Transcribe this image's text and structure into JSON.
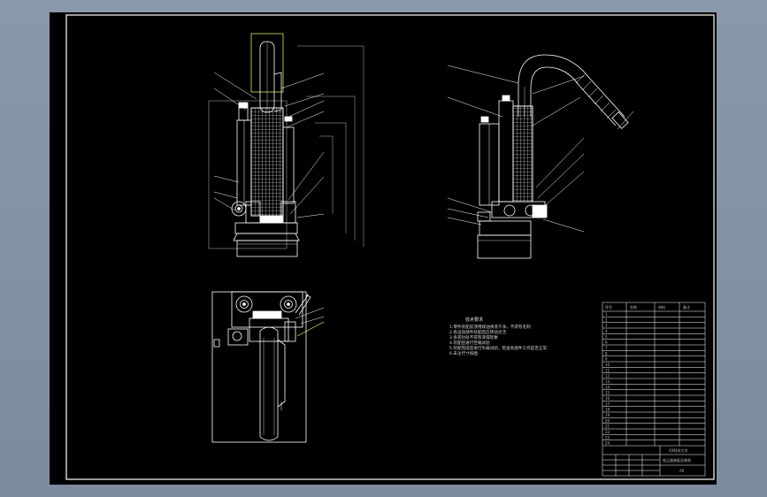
{
  "colors": {
    "background": "#8593a7",
    "sheet": "#000000",
    "line": "#ffffff",
    "balloon": "#c8c8c8",
    "accent": "#ffff66"
  },
  "notes": {
    "title": "技术要求",
    "lines": [
      "1.零件装配前须用煤油清洗干净，不得有毛刺",
      "2.各运动部件装配后应转动灵活",
      "3.各密封处不得有渗漏现象",
      "4.装配后进行空载试验",
      "5.装配完成后进行负载试验，检查各部件工作是否正常",
      "6.未注尺寸按图"
    ]
  },
  "bom": {
    "headers": [
      "序号",
      "名称",
      "材料",
      "备注"
    ],
    "rows": [
      [
        "1",
        "",
        "",
        ""
      ],
      [
        "2",
        "",
        "",
        ""
      ],
      [
        "3",
        "",
        "",
        ""
      ],
      [
        "4",
        "",
        "",
        ""
      ],
      [
        "5",
        "",
        "",
        ""
      ],
      [
        "6",
        "",
        "",
        ""
      ],
      [
        "7",
        "",
        "",
        ""
      ],
      [
        "8",
        "",
        "",
        ""
      ],
      [
        "9",
        "",
        "",
        ""
      ],
      [
        "10",
        "",
        "",
        ""
      ],
      [
        "11",
        "",
        "",
        ""
      ],
      [
        "12",
        "",
        "",
        ""
      ],
      [
        "13",
        "",
        "",
        ""
      ],
      [
        "14",
        "",
        "",
        ""
      ],
      [
        "15",
        "",
        "",
        ""
      ],
      [
        "16",
        "",
        "",
        ""
      ],
      [
        "17",
        "",
        "",
        ""
      ],
      [
        "18",
        "",
        "",
        ""
      ],
      [
        "19",
        "",
        "",
        ""
      ],
      [
        "20",
        "",
        "",
        ""
      ],
      [
        "21",
        "",
        "",
        ""
      ],
      [
        "22",
        "",
        "",
        ""
      ],
      [
        "23",
        "",
        "",
        ""
      ],
      [
        "24",
        "",
        "",
        ""
      ]
    ]
  },
  "title_block": {
    "school": "XX科技大学",
    "drawing_name": "吸尘器装配总装图",
    "sheet_no": "A0"
  }
}
